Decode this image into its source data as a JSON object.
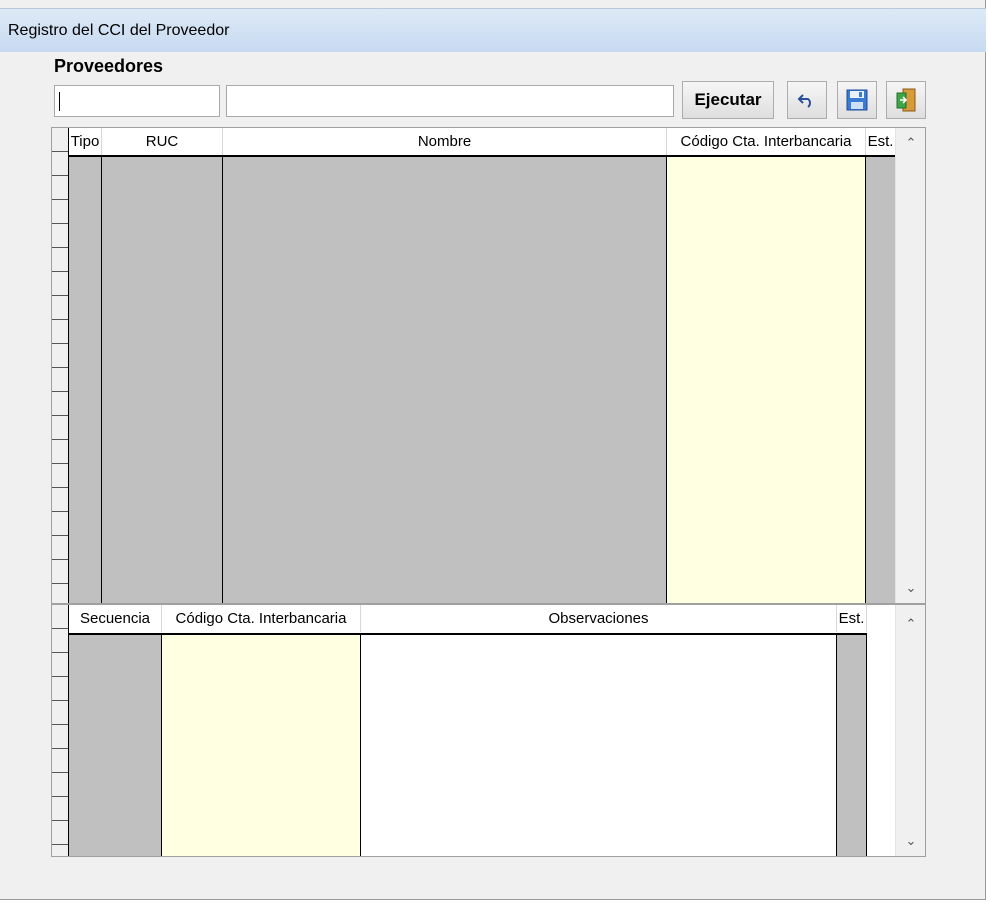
{
  "window": {
    "title": "Registro del CCI del Proveedor"
  },
  "proveedores": {
    "label": "Proveedores",
    "code_input": {
      "value": "",
      "placeholder": ""
    },
    "name_input": {
      "value": "",
      "placeholder": ""
    },
    "execute_label": "Ejecutar"
  },
  "toolbar": {
    "icons": [
      "undo-icon",
      "save-icon",
      "exit-icon"
    ]
  },
  "grid_proveedores": {
    "columns": [
      "Tipo",
      "RUC",
      "Nombre",
      "Código Cta. Interbancaria",
      "Est."
    ],
    "rows": []
  },
  "grid_cuentas": {
    "columns": [
      "Secuencia",
      "Código Cta. Interbancaria",
      "Observaciones",
      "Est."
    ],
    "rows": []
  },
  "colors": {
    "readonly_column": "#c0c0c0",
    "editable_highlight": "#ffffe1",
    "titlebar": "#c7daf1"
  }
}
